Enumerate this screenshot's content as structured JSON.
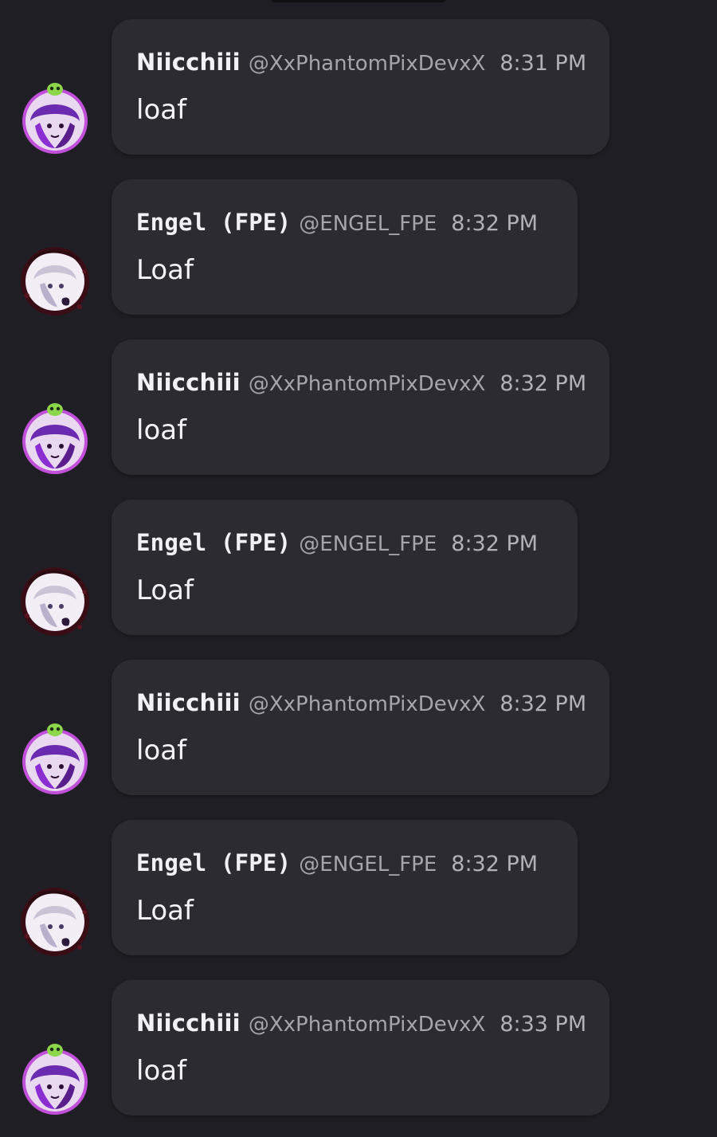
{
  "colors": {
    "background": "#1f1e24",
    "bubble": "#2c2b32",
    "name": "#f2f1f5",
    "handle": "#a6a5ae",
    "message": "#f4f3f7",
    "avatar_ring_purple": "#b657e6",
    "avatar_ring_dark": "#2a0b12"
  },
  "messages": [
    {
      "name": "Niicchiii",
      "handle": "@XxPhantomPixDevxX",
      "time": "8:31 PM",
      "text": "loaf",
      "avatar_icon": "purple-hair-avatar-icon"
    },
    {
      "name": "Engel (FPE)",
      "handle": "@ENGEL_FPE",
      "time": "8:32 PM",
      "text": "Loaf",
      "avatar_icon": "white-hair-avatar-icon"
    },
    {
      "name": "Niicchiii",
      "handle": "@XxPhantomPixDevxX",
      "time": "8:32 PM",
      "text": "loaf",
      "avatar_icon": "purple-hair-avatar-icon"
    },
    {
      "name": "Engel (FPE)",
      "handle": "@ENGEL_FPE",
      "time": "8:32 PM",
      "text": "Loaf",
      "avatar_icon": "white-hair-avatar-icon"
    },
    {
      "name": "Niicchiii",
      "handle": "@XxPhantomPixDevxX",
      "time": "8:32 PM",
      "text": "loaf",
      "avatar_icon": "purple-hair-avatar-icon"
    },
    {
      "name": "Engel (FPE)",
      "handle": "@ENGEL_FPE",
      "time": "8:32 PM",
      "text": "Loaf",
      "avatar_icon": "white-hair-avatar-icon"
    },
    {
      "name": "Niicchiii",
      "handle": "@XxPhantomPixDevxX",
      "time": "8:33 PM",
      "text": "loaf",
      "avatar_icon": "purple-hair-avatar-icon"
    }
  ]
}
